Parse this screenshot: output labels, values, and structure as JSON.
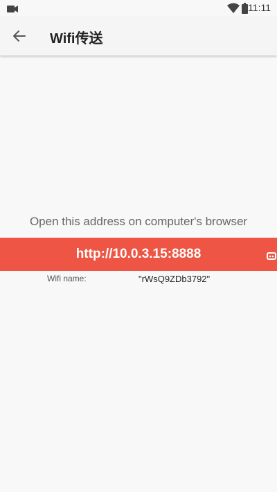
{
  "status_bar": {
    "time": "11:11",
    "icons": [
      "video-camera-icon",
      "wifi-signal-icon",
      "battery-icon"
    ]
  },
  "app_bar": {
    "title": "Wifi传送",
    "back_icon": "arrow-back-icon"
  },
  "main": {
    "instruction": "Open this address on computer's browser",
    "address": "http://10.0.3.15:8888",
    "wifi_label": "Wifi name:",
    "wifi_name": "\"rWsQ9ZDb3792\""
  },
  "colors": {
    "accent": "#ee5544",
    "background": "#f8f8f8",
    "app_bar": "#f5f5f5"
  }
}
